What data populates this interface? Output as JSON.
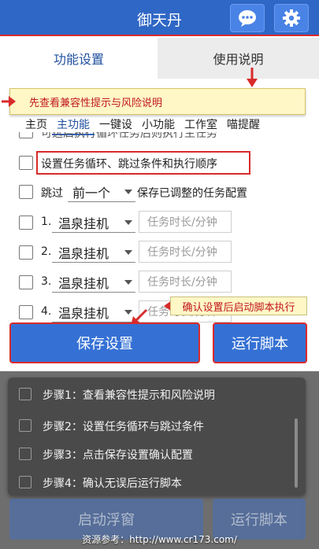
{
  "app": {
    "title": "御天丹"
  },
  "top_tabs": [
    {
      "label": "功能设置",
      "active": true
    },
    {
      "label": "使用说明",
      "active": false
    }
  ],
  "warning_callout": "先查看兼容性提示与风险说明",
  "sub_tabs": [
    {
      "label": "主页",
      "active": false
    },
    {
      "label": "主功能",
      "active": true
    },
    {
      "label": "一键设",
      "active": false
    },
    {
      "label": "小功能",
      "active": false
    },
    {
      "label": "工作室",
      "active": false
    },
    {
      "label": "喵提醒",
      "active": false
    }
  ],
  "settings": {
    "partial_row_text": "可选启执行循环任务后则执行主任务",
    "loop_row_text": "设置任务循环、跳过条件和执行顺序",
    "skip_row": {
      "label": "跳过",
      "select_value": "前一个",
      "suffix": "保存已调整的任务配置"
    },
    "task_rows": [
      {
        "number": "1.",
        "select_value": "温泉挂机",
        "placeholder": "任务时长/分钟"
      },
      {
        "number": "2.",
        "select_value": "温泉挂机",
        "placeholder": "任务时长/分钟"
      },
      {
        "number": "3.",
        "select_value": "温泉挂机",
        "placeholder": "任务时长/分钟"
      },
      {
        "number": "4.",
        "select_value": "温泉挂机",
        "placeholder": "任务时长/分钟"
      }
    ]
  },
  "run_callout": "确认设置后启动脚本执行",
  "buttons": {
    "save": "保存设置",
    "run": "运行脚本",
    "float": "启动浮窗",
    "run_bottom": "运行脚本"
  },
  "steps": [
    "步骤1：查看兼容性提示和风险说明",
    "步骤2：设置任务循环与跳过条件",
    "步骤3：点击保存设置确认配置",
    "步骤4：确认无误后运行脚本"
  ],
  "footer": "资源参考：http://www.cr173.com/",
  "colors": {
    "primary": "#2f67c6",
    "highlight": "#d92b2b",
    "callout_bg": "#fff7c6"
  }
}
